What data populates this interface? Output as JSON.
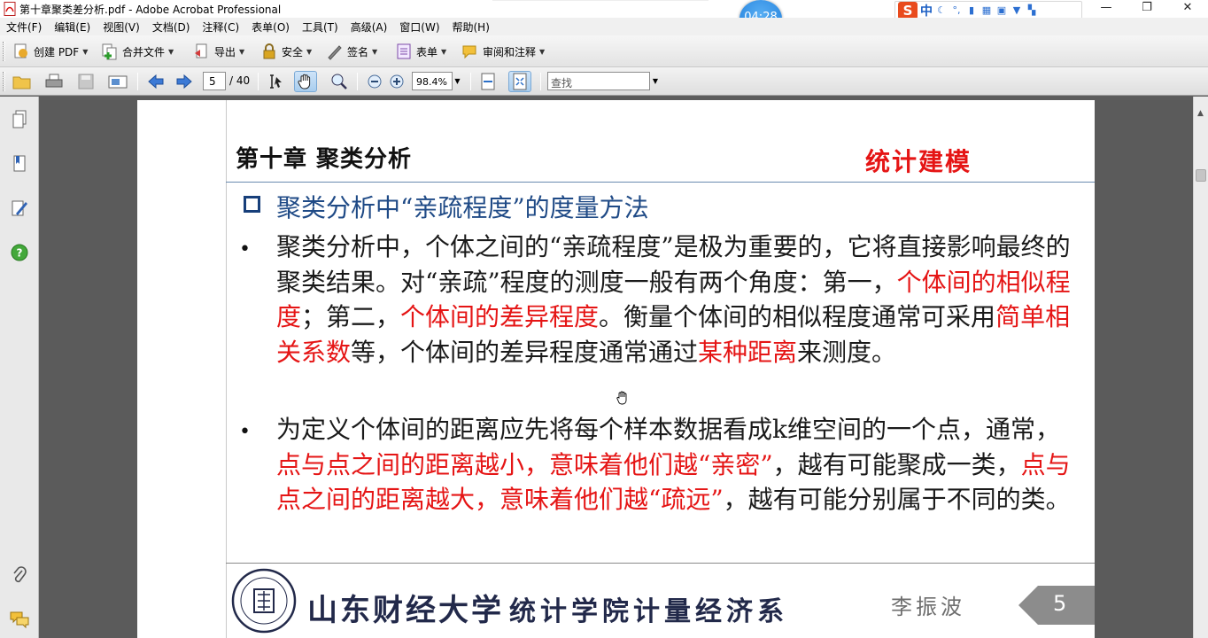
{
  "window": {
    "title": "第十章聚类差分析.pdf - Adobe Acrobat Professional",
    "minimize_glyph": "—",
    "restore_glyph": "❐",
    "close_glyph": "✕"
  },
  "ime": {
    "lang": "中"
  },
  "timer": {
    "time": "04:28"
  },
  "menubar": {
    "items": [
      {
        "label": "文件(F)"
      },
      {
        "label": "编辑(E)"
      },
      {
        "label": "视图(V)"
      },
      {
        "label": "文档(D)"
      },
      {
        "label": "注释(C)"
      },
      {
        "label": "表单(O)"
      },
      {
        "label": "工具(T)"
      },
      {
        "label": "高级(A)"
      },
      {
        "label": "窗口(W)"
      },
      {
        "label": "帮助(H)"
      }
    ]
  },
  "toolbar": {
    "create_pdf": "创建 PDF",
    "combine": "合并文件",
    "export": "导出",
    "security": "安全",
    "sign": "签名",
    "forms": "表单",
    "review": "审阅和注释"
  },
  "navigation": {
    "current_page": "5",
    "total_pages": "/ 40",
    "zoom": "98.4%",
    "find_placeholder": "查找"
  },
  "document": {
    "chapter_title": "第十章 聚类分析",
    "course_tag": "统计建模",
    "section_title": "聚类分析中“亲疏程度”的度量方法",
    "para1": {
      "t1": "聚类分析中，个体之间的“亲疏程度”是极为重要的，它将直接影响最终的聚类结果。对“亲疏”程度的测度一般有两个角度：第一，",
      "h1": "个体间的相似程度",
      "t2": "；第二，",
      "h2": "个体间的差异程度",
      "t3": "。衡量个体间的相似程度通常可采用",
      "h3": "简单相关系数",
      "t4": "等，个体间的差异程度通常通过",
      "h4": "某种距离",
      "t5": "来测度。"
    },
    "para2": {
      "t1": "为定义个体间的距离应先将每个样本数据看成k维空间的一个点，通常，",
      "h1": "点与点之间的距离越小，意味着他们越“亲密”",
      "t2": "，越有可能聚成一类，",
      "h2": "点与点之间的距离越大，意味着他们越“疏远”",
      "t3": "，越有可能分别属于不同的类。"
    },
    "footer": {
      "university": "山东财经大学",
      "department": "统计学院计量经济系",
      "author": "李振波",
      "page_number": "5"
    }
  },
  "colors": {
    "highlight_red": "#e51515",
    "section_blue": "#1f4a86",
    "viewer_bg": "#5b5b5b"
  }
}
